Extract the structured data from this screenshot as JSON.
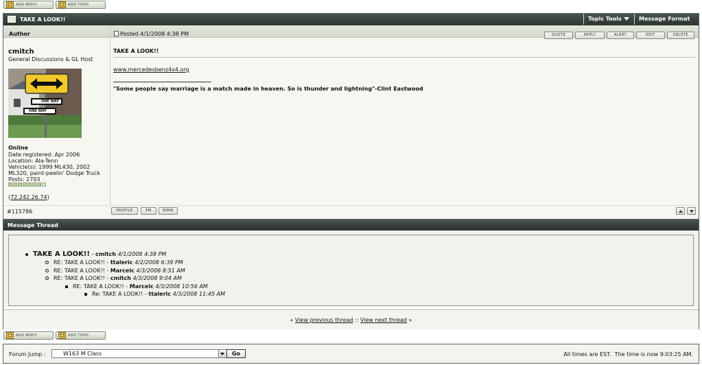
{
  "toolbar": {
    "add_reply": "ADD REPLY",
    "add_topic": "ADD TOPIC"
  },
  "topic": {
    "title": "TAKE A LOOK!!",
    "tools_label": "Topic Tools",
    "format_label": "Message Format"
  },
  "post": {
    "author_header": "Author",
    "posted": "Posted 4/1/2008 4:38 PM",
    "buttons": {
      "quote": "QUOTE",
      "reply": "REPLY",
      "alert": "ALERT",
      "edit": "EDIT",
      "delete": "DELETE"
    },
    "author": {
      "name": "cmitch",
      "group": "General Discussions & GL Host",
      "status": "Online",
      "registered": "Date registered: Apr 2006",
      "location": "Location: Ala-Tenn",
      "vehicles_1": "Vehicle(s): 1999 ML430, 2002",
      "vehicles_2": "ML320, paint-peelin' Dodge Truck",
      "posts": "Posts: 2703",
      "ip": "72.242.26.74",
      "rank_pips": 8
    },
    "avatar_signs": {
      "one_way_1": "ONE WAY",
      "one_way_2": "ONE WAY"
    },
    "subject": "TAKE A LOOK!!",
    "link": "www.mercedesbenz4x4.org",
    "signature": "\"Some people say marriage is a match made in heaven. So is thunder and lightning\"-Clint Eastwood",
    "post_id": "#115786",
    "footer_buttons": {
      "profile": "PROFILE",
      "pm": "PM",
      "www": "WWW"
    }
  },
  "thread": {
    "header": "Message Thread",
    "items": [
      {
        "title": "TAKE A LOOK!!",
        "author": "cmitch",
        "date": "4/1/2008 4:38 PM"
      },
      {
        "title": "RE: TAKE A LOOK!!",
        "author": "ttaleric",
        "date": "4/2/2008 6:39 PM"
      },
      {
        "title": "RE: TAKE A LOOK!!",
        "author": "Marcelc",
        "date": "4/3/2008 8:51 AM"
      },
      {
        "title": "RE: TAKE A LOOK!!",
        "author": "cmitch",
        "date": "4/3/2008 9:04 AM"
      },
      {
        "title": "RE: TAKE A LOOK!!",
        "author": "Marcelc",
        "date": "4/3/2008 10:56 AM"
      },
      {
        "title": "Re: TAKE A LOOK!!",
        "author": "ttaleric",
        "date": "4/3/2008 11:45 AM"
      }
    ],
    "sep": " - "
  },
  "nav": {
    "prefix": "« ",
    "prev": "View previous thread",
    "middle": " :: ",
    "next": "View next thread",
    "suffix": " »"
  },
  "footer": {
    "jump_label": "Forum Jump :",
    "jump_value": "W163 M Class",
    "go": "Go",
    "times": "All times are EST.  The time is now 9:03:25 AM."
  }
}
